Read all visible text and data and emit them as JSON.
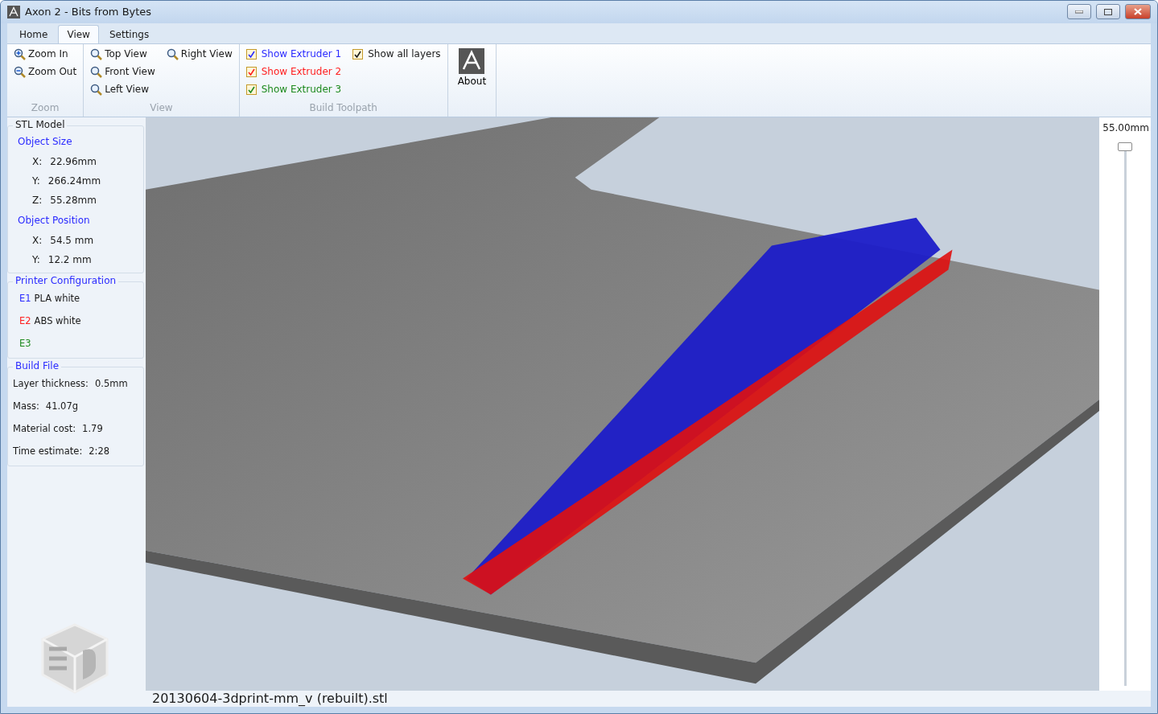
{
  "window": {
    "title": "Axon 2 - Bits from Bytes"
  },
  "tabs": [
    {
      "label": "Home",
      "selected": false
    },
    {
      "label": "View",
      "selected": true
    },
    {
      "label": "Settings",
      "selected": false
    }
  ],
  "ribbon": {
    "groups": [
      {
        "title": "Zoom",
        "kind": "zoom",
        "columns": [
          [
            {
              "label": "Zoom In"
            },
            {
              "label": "Zoom Out"
            }
          ]
        ]
      },
      {
        "title": "View",
        "kind": "buttons",
        "columns": [
          [
            {
              "label": "Top View"
            },
            {
              "label": "Front View"
            },
            {
              "label": "Left View"
            }
          ],
          [
            {
              "label": "Right View"
            }
          ]
        ]
      },
      {
        "title": "Build Toolpath",
        "kind": "checks",
        "columns": [
          [
            {
              "label": "Show Extruder 1",
              "checked": true,
              "color": "#2b2bff"
            },
            {
              "label": "Show Extruder 2",
              "checked": true,
              "color": "#ff2020"
            },
            {
              "label": "Show Extruder 3",
              "checked": true,
              "color": "#1e8a1e"
            }
          ],
          [
            {
              "label": "Show all layers",
              "checked": true,
              "color": "#1a1a1a"
            }
          ]
        ]
      },
      {
        "kind": "about",
        "columns": [
          [
            {
              "label": "About"
            }
          ]
        ]
      }
    ]
  },
  "sidebar": {
    "stl_model": {
      "title": "STL Model",
      "object_size": {
        "heading": "Object Size",
        "rows": [
          {
            "axis": "X:",
            "value": "22.96mm"
          },
          {
            "axis": "Y:",
            "value": "266.24mm"
          },
          {
            "axis": "Z:",
            "value": "55.28mm"
          }
        ]
      },
      "object_position": {
        "heading": "Object Position",
        "rows": [
          {
            "axis": "X:",
            "value": "54.5 mm"
          },
          {
            "axis": "Y:",
            "value": "12.2 mm"
          }
        ]
      }
    },
    "printer_configuration": {
      "title": "Printer Configuration",
      "extruders": [
        {
          "id": "E1",
          "material": "PLA white",
          "color": "#2b2bff"
        },
        {
          "id": "E2",
          "material": "ABS white",
          "color": "#ff2020"
        },
        {
          "id": "E3",
          "color": "#1e8a1e"
        }
      ]
    },
    "build_file": {
      "title": "Build File",
      "rows": [
        {
          "label": "Layer thickness:",
          "value": "0.5mm"
        },
        {
          "label": "Mass:",
          "value": "41.07g"
        },
        {
          "label": "Material cost:",
          "value": "1.79"
        },
        {
          "label": "Time estimate:",
          "value": "2:28"
        }
      ]
    }
  },
  "viewport": {
    "filename": "20130604-3dprint-mm_v (rebuilt).stl"
  },
  "layer_slider": {
    "reading": "55.00mm",
    "level": 1
  }
}
